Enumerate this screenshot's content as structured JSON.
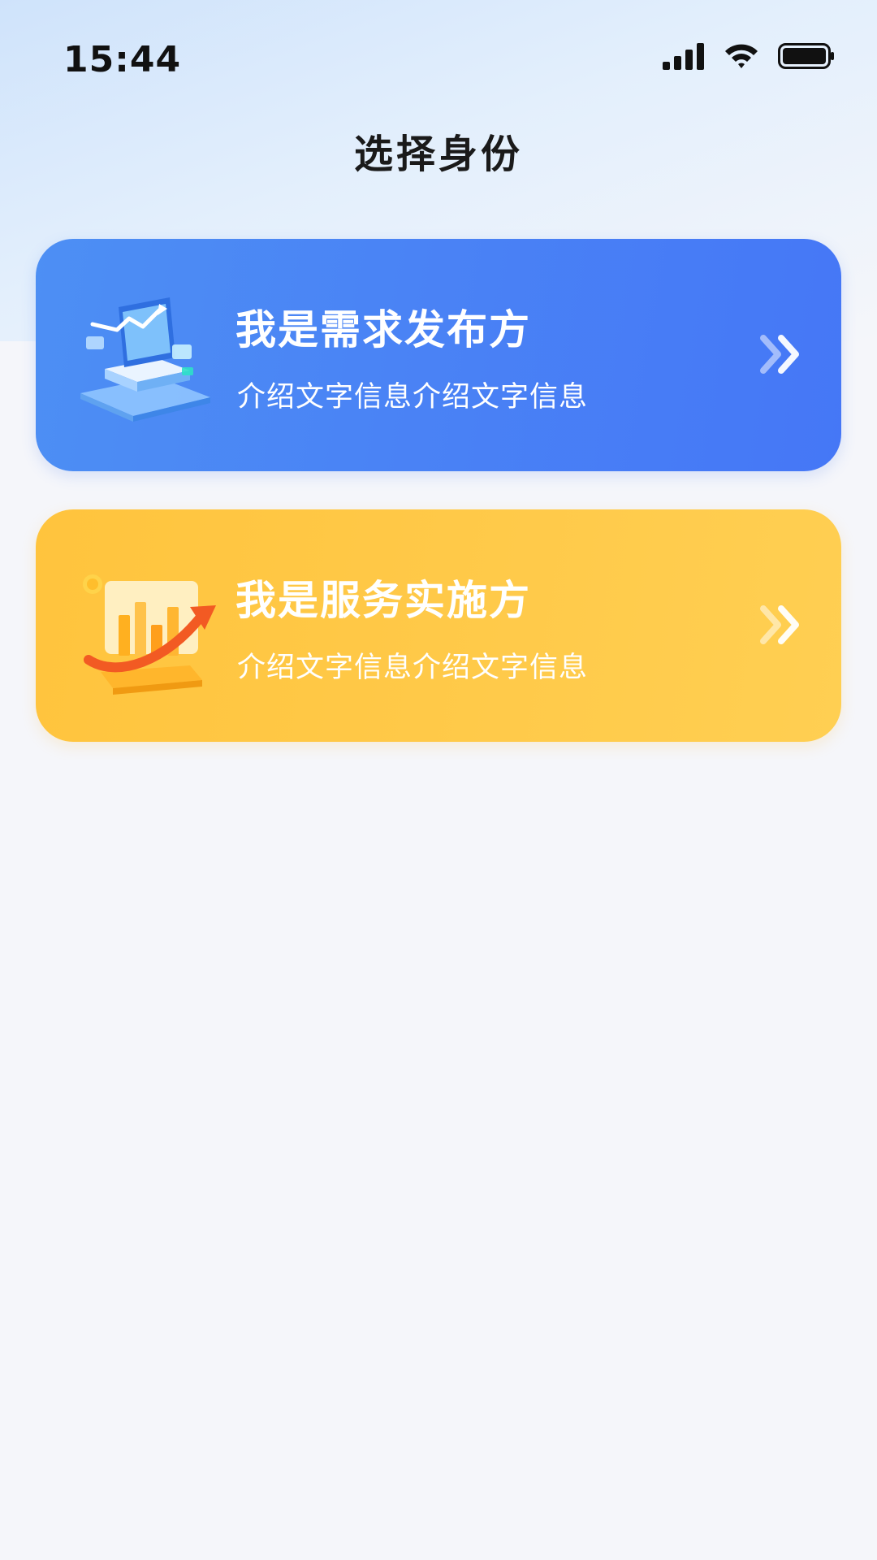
{
  "status_bar": {
    "time": "15:44",
    "icons": [
      "cellular-signal-icon",
      "wifi-icon",
      "battery-icon"
    ]
  },
  "header": {
    "title": "选择身份"
  },
  "cards": [
    {
      "title": "我是需求发布方",
      "description": "介绍文字信息介绍文字信息",
      "icon": "monitor-chart-illustration",
      "arrow_icon": "double-chevron-right-icon",
      "color": "#4a83f5"
    },
    {
      "title": "我是服务实施方",
      "description": "介绍文字信息介绍文字信息",
      "icon": "bar-chart-arrow-illustration",
      "arrow_icon": "double-chevron-right-icon",
      "color": "#ffc948"
    }
  ]
}
